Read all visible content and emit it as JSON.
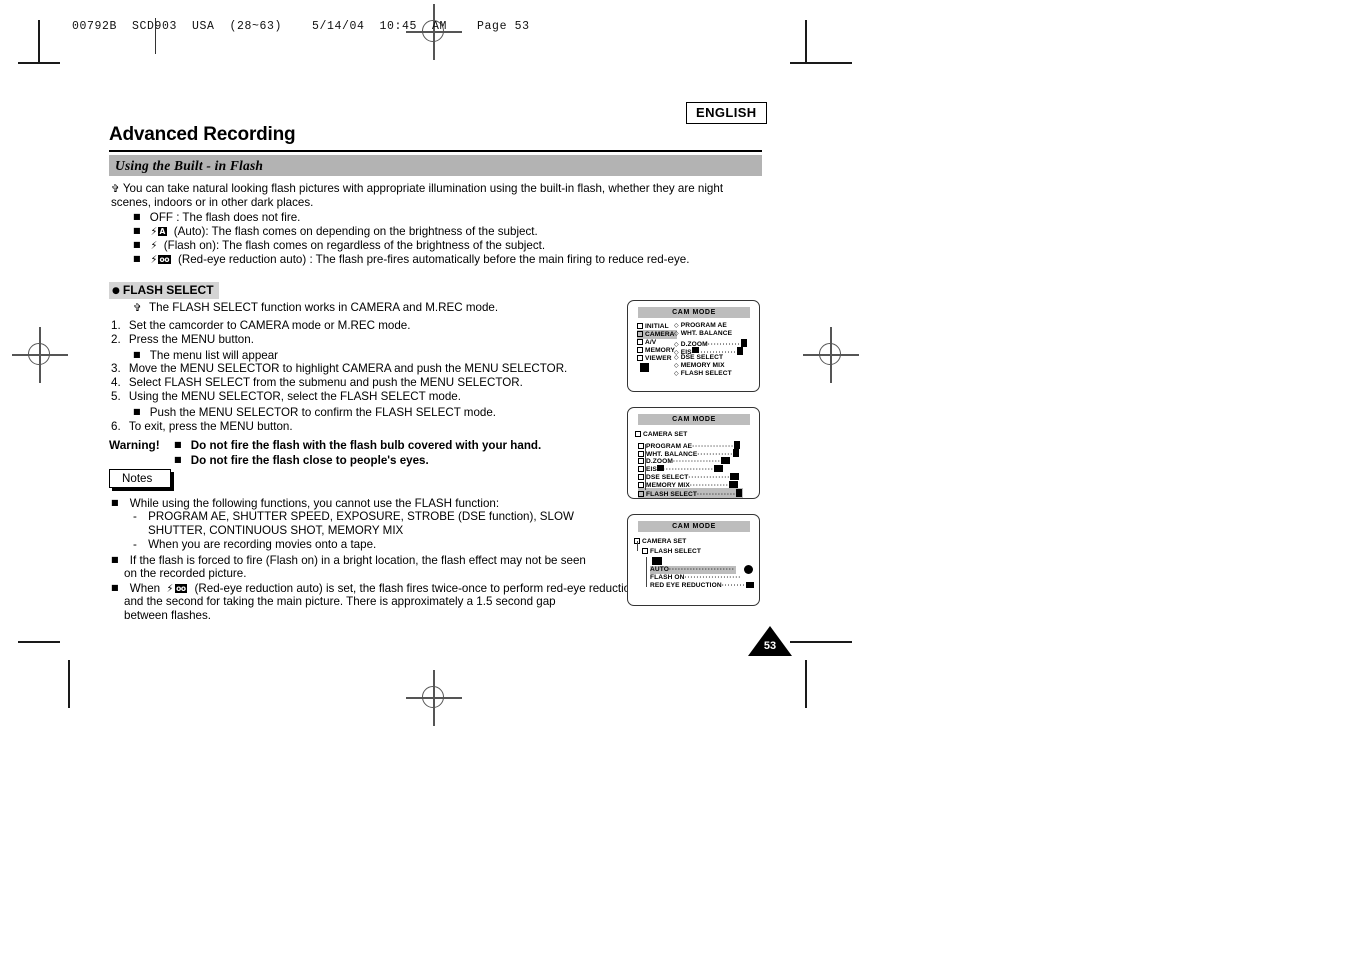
{
  "print_marks": {
    "slug": "00792B  SCD903  USA  (28~63)    5/14/04  10:45  AM    Page 53"
  },
  "header": {
    "language_badge": "ENGLISH",
    "chapter_title": "Advanced Recording",
    "section_title": "Using the Built - in Flash"
  },
  "intro": {
    "lead": "You can take natural looking flash pictures with appropriate illumination using the built-in flash, whether they are night scenes, indoors or in other dark places.",
    "modes": [
      {
        "icon": "none",
        "text": "OFF : The flash does not fire."
      },
      {
        "icon": "flash-auto-icon",
        "badge": "A",
        "text": "(Auto): The flash comes on depending on the brightness of the subject."
      },
      {
        "icon": "flash-on-icon",
        "badge": "",
        "text": "(Flash on): The flash comes on regardless of the brightness of the subject."
      },
      {
        "icon": "flash-redeye-icon",
        "badge": "oo",
        "text": "(Red-eye reduction auto) : The flash pre-fires automatically before the main firing to reduce red-eye."
      }
    ]
  },
  "flash_select": {
    "heading": "FLASH SELECT",
    "note": "The FLASH SELECT function works in CAMERA and M.REC mode.",
    "steps": [
      {
        "num": "1.",
        "text": "Set the camcorder to CAMERA mode or M.REC mode."
      },
      {
        "num": "2.",
        "text": "Press the MENU button."
      },
      {
        "num": "3.",
        "text": "Move the MENU SELECTOR to highlight CAMERA and push the MENU SELECTOR."
      },
      {
        "num": "4.",
        "text": "Select FLASH SELECT from the submenu and push the MENU SELECTOR."
      },
      {
        "num": "5.",
        "text": "Using the MENU SELECTOR, select the FLASH SELECT mode."
      },
      {
        "num": "6.",
        "text": "To exit, press the MENU button."
      }
    ],
    "sub_step_2": "The menu list will appear",
    "sub_step_5": "Push the MENU SELECTOR to confirm the FLASH SELECT mode."
  },
  "warning": {
    "label": "Warning!",
    "items": [
      "Do not fire the flash with the flash bulb covered with your hand.",
      "Do not fire the flash close to people's eyes."
    ]
  },
  "notes": {
    "label": "Notes",
    "items": [
      {
        "text": "While using the following functions, you cannot use the FLASH function:",
        "subitems": [
          "PROGRAM AE, SHUTTER SPEED, EXPOSURE, STROBE (DSE function), SLOW",
          "SHUTTER, CONTINUOUS SHOT, MEMORY MIX",
          "When you are recording movies onto a tape."
        ]
      },
      {
        "text_line1": "If the flash is forced to fire (Flash on) in a bright location, the flash effect may not be seen",
        "text_line2": "on the recorded picture."
      },
      {
        "text_pre": "When",
        "icon": "flash-redeye-icon",
        "badge": "oo",
        "text_line1": "(Red-eye reduction auto) is set, the flash fires twice-once to perform red-eye reduction",
        "text_line2": "and the second for taking the main picture. There is approximately a 1.5 second gap",
        "text_line3": "between flashes."
      }
    ]
  },
  "osd_screens": [
    {
      "title": "CAM MODE",
      "left_column": [
        "INITIAL",
        "CAMERA",
        "A/V",
        "MEMORY",
        "VIEWER"
      ],
      "left_selected": "CAMERA",
      "right_column": [
        "PROGRAM AE",
        "WHT. BALANCE",
        "D.ZOOM",
        "EIS",
        "DSE SELECT",
        "MEMORY MIX",
        "FLASH SELECT"
      ]
    },
    {
      "title": "CAM MODE",
      "breadcrumb": "CAMERA SET",
      "items": [
        "PROGRAM AE",
        "WHT. BALANCE",
        "D.ZOOM",
        "EIS",
        "DSE SELECT",
        "MEMORY MIX",
        "FLASH SELECT"
      ],
      "selected": "FLASH SELECT"
    },
    {
      "title": "CAM MODE",
      "breadcrumb": "CAMERA SET",
      "submenu": "FLASH SELECT",
      "options": [
        "AUTO",
        "FLASH ON",
        "RED EYE REDUCTION"
      ],
      "selected": "AUTO"
    }
  ],
  "page_number": "53"
}
